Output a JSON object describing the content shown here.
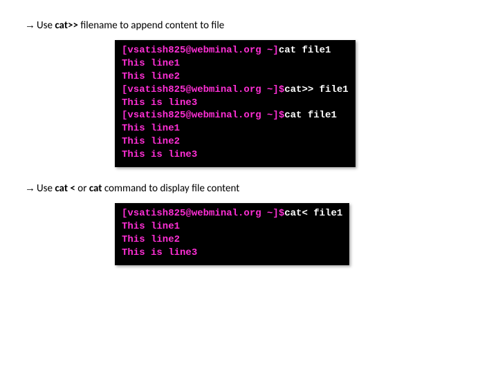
{
  "section1": {
    "arrow": "→",
    "pre": "Use ",
    "bold": "cat>>",
    "post": " filename to append content to file",
    "terminal": {
      "l1_prompt": "[vsatish825@webminal.org ~]",
      "l1_cmd": "cat file1",
      "l2": "This line1",
      "l3": "This line2",
      "l4_prompt": "[vsatish825@webminal.org ~]$",
      "l4_cmd": "cat>> file1",
      "l5": "This is line3",
      "l6_prompt": "[vsatish825@webminal.org ~]$",
      "l6_cmd": "cat file1",
      "l7": "This line1",
      "l8": "This line2",
      "l9": "This is line3"
    }
  },
  "section2": {
    "arrow": "→",
    "pre": "Use ",
    "bold1": "cat <",
    "mid": "  or  ",
    "bold2": "cat",
    "post": "   command to display file content",
    "terminal": {
      "l1_prompt": "[vsatish825@webminal.org ~]$",
      "l1_cmd": "cat< file1",
      "l2": "This line1",
      "l3": "This line2",
      "l4": "This is line3"
    }
  }
}
